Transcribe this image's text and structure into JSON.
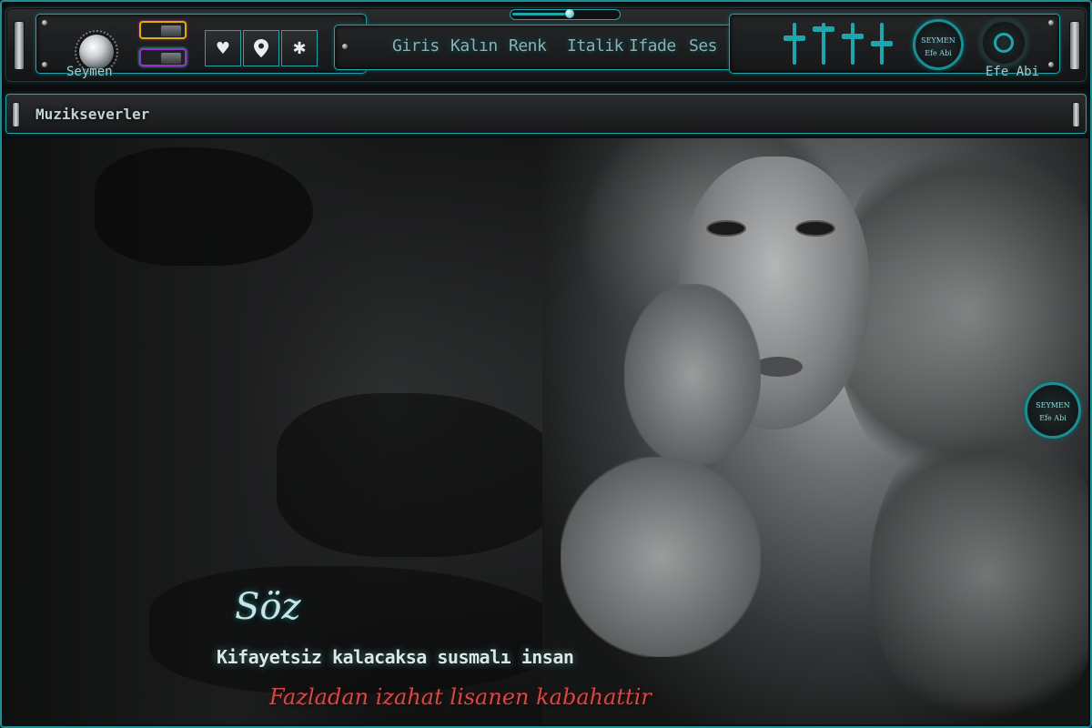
{
  "toolbar": {
    "knob_label": "Seymen",
    "menu": [
      "Giris",
      "Kalın",
      "Renk",
      "Italik",
      "Ifade",
      "Ses"
    ],
    "right_label": "Efe Abi",
    "badge_top": "SEYMEN",
    "badge_bottom": "Efe Abi",
    "icons": [
      "heart-icon",
      "location-pin-icon",
      "gear-icon"
    ],
    "volume_level": 0.55
  },
  "titlebar": {
    "title": "Muzikseverler"
  },
  "quote": {
    "heading": "Söz",
    "line1": "Kifayetsiz kalacaksa susmalı insan",
    "line2": "Fazladan izahat lisanen kabahattir"
  },
  "watermark": {
    "top": "SEYMEN",
    "bottom": "Efe Abi"
  },
  "colors": {
    "accent": "#1fa6ad",
    "quote_red": "#d04a4a"
  }
}
